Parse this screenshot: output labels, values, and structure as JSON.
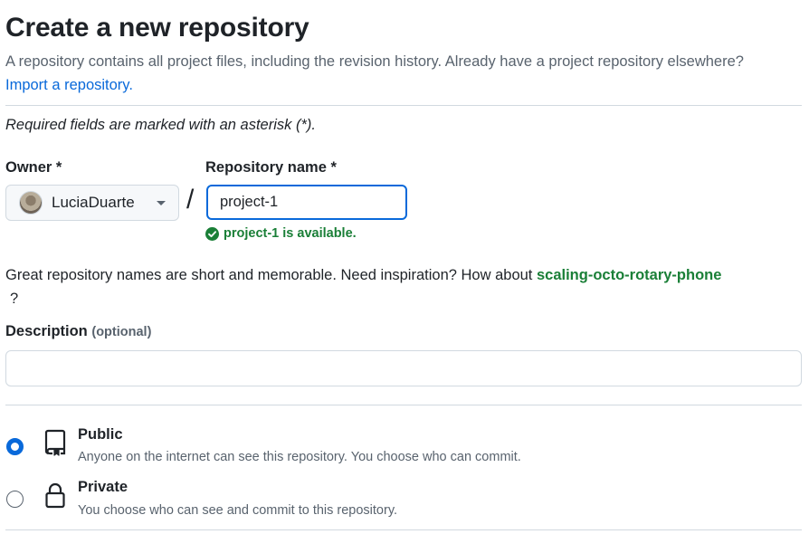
{
  "header": {
    "title": "Create a new repository",
    "subtitle": "A repository contains all project files, including the revision history. Already have a project repository elsewhere?",
    "import_link": "Import a repository."
  },
  "form": {
    "required_note": "Required fields are marked with an asterisk (*).",
    "owner": {
      "label": "Owner *",
      "value": "LuciaDuarte"
    },
    "separator": "/",
    "repo_name": {
      "label": "Repository name *",
      "value": "project-1",
      "availability": "project-1 is available."
    },
    "inspiration": {
      "text": "Great repository names are short and memorable. Need inspiration? How about",
      "suggestion": "scaling-octo-rotary-phone",
      "trailing": "?"
    },
    "description": {
      "label": "Description",
      "optional": "(optional)",
      "value": ""
    },
    "visibility": [
      {
        "title": "Public",
        "description": "Anyone on the internet can see this repository. You choose who can commit.",
        "icon": "repo-icon",
        "selected": true
      },
      {
        "title": "Private",
        "description": "You choose who can see and commit to this repository.",
        "icon": "lock-icon",
        "selected": false
      }
    ]
  },
  "colors": {
    "accent": "#0969da",
    "success": "#1a7f37",
    "muted": "#59636e",
    "border": "#d1d9e0"
  }
}
